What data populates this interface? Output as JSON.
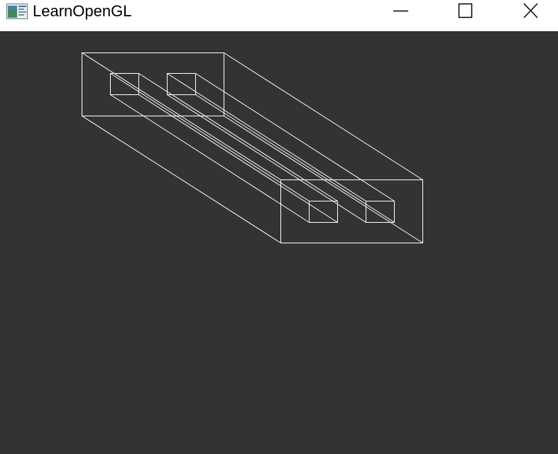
{
  "window": {
    "title": "LearnOpenGL",
    "icon": "opengl-app-icon",
    "controls": {
      "minimize_icon": "minimize-icon",
      "maximize_icon": "maximize-icon",
      "close_icon": "close-icon"
    }
  },
  "scene": {
    "background_color": "#333333",
    "line_color": "#ffffff",
    "render_mode": "wireframe"
  }
}
